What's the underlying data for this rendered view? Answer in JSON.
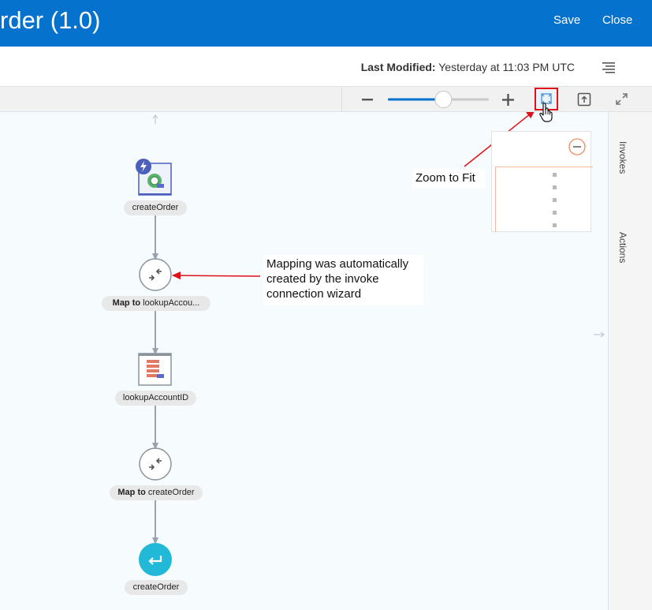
{
  "header": {
    "title": "rder (1.0)",
    "save_label": "Save",
    "close_label": "Close"
  },
  "subheader": {
    "last_modified_label": "Last Modified:",
    "last_modified_value": "Yesterday at 11:03 PM UTC"
  },
  "toolbar": {
    "zoom_level_fraction": 0.55
  },
  "side_tabs": {
    "invokes": "Invokes",
    "actions": "Actions"
  },
  "flow": {
    "nodes": [
      {
        "label": "createOrder",
        "type": "trigger"
      },
      {
        "label_bold": "Map to",
        "label_rest": " lookupAccou...",
        "type": "map"
      },
      {
        "label": "lookupAccountID",
        "type": "invoke"
      },
      {
        "label_bold": "Map to",
        "label_rest": " createOrder",
        "type": "map"
      },
      {
        "label": "createOrder",
        "type": "return"
      }
    ]
  },
  "annotations": {
    "mapping_note_lines": [
      "Mapping was automatically",
      "created by the invoke",
      "connection wizard"
    ],
    "zoom_note": "Zoom to Fit"
  },
  "colors": {
    "header_bg": "#0572ce",
    "accent_red": "#e0101a",
    "return_node": "#22b8d8",
    "trigger_badge": "#4b5fbd",
    "minimap_accent": "#f08a5d"
  },
  "icons": {
    "menu": "hamburger-menu-icon",
    "zoom_out": "minus-icon",
    "zoom_in": "plus-icon",
    "zoom_fit": "zoom-to-fit-icon",
    "export": "export-image-icon",
    "fullscreen": "expand-icon",
    "pointer": "hand-cursor-icon"
  }
}
